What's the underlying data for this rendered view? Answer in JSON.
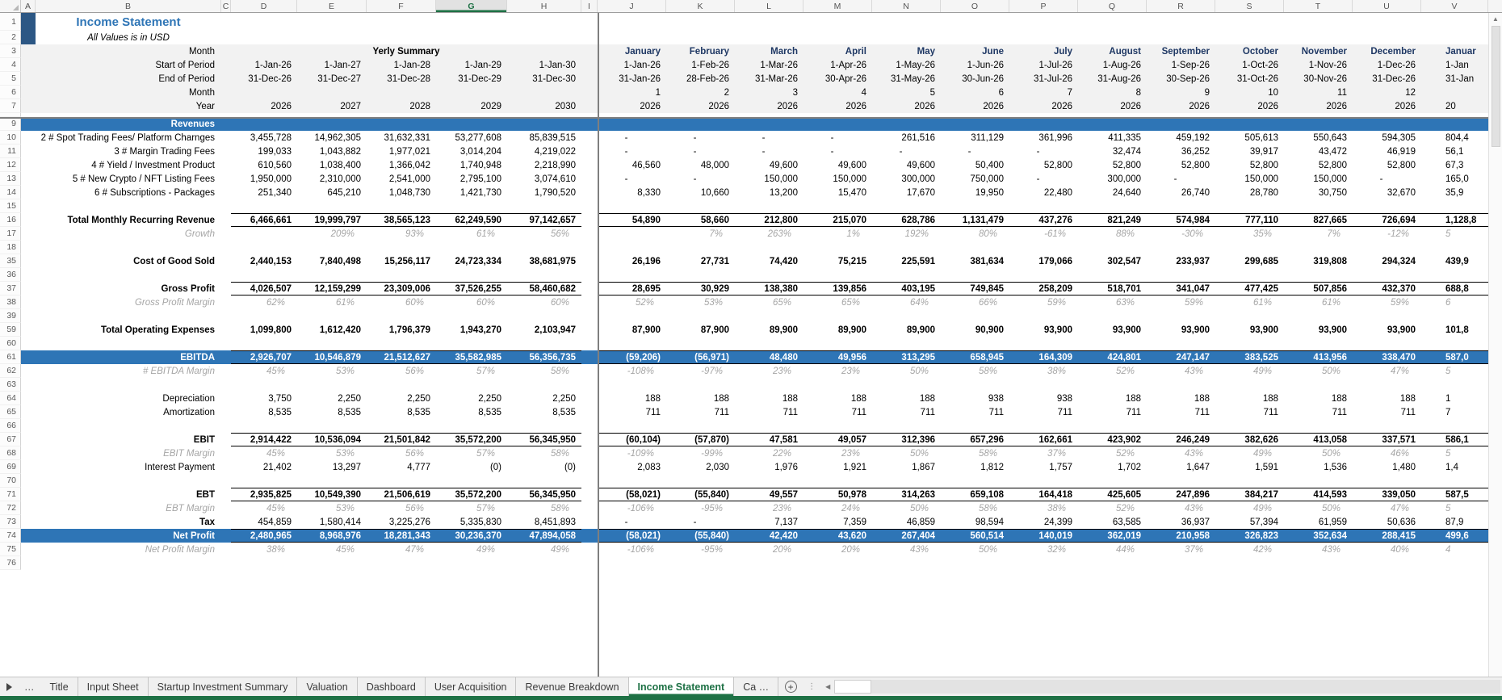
{
  "colors": {
    "banner_blue": "#2E75B6",
    "title_blue": "#2E75B6",
    "month_navy": "#1F3864",
    "side_bar_blue": "#2C5784",
    "excel_green": "#1E7145",
    "gray_text": "#A6A6A6",
    "header_bg": "#F2F2F2"
  },
  "columns": {
    "letters": [
      "A",
      "B",
      "C",
      "D",
      "E",
      "F",
      "G",
      "H",
      "I",
      "J",
      "K",
      "L",
      "M",
      "N",
      "O",
      "P",
      "Q",
      "R",
      "S",
      "T",
      "U",
      "V"
    ],
    "selected": "G"
  },
  "sheet": {
    "title": "Income Statement",
    "subtitle": "All Values is in USD",
    "header": {
      "row3_label": "Month",
      "yearly_span": "Yerly Summary",
      "row4_label": "Start of Period",
      "row5_label": "End of Period",
      "row6_label": "Month",
      "row7_label": "Year",
      "yearly_start": [
        "1-Jan-26",
        "1-Jan-27",
        "1-Jan-28",
        "1-Jan-29",
        "1-Jan-30"
      ],
      "yearly_end": [
        "31-Dec-26",
        "31-Dec-27",
        "31-Dec-28",
        "31-Dec-29",
        "31-Dec-30"
      ],
      "yearly_years": [
        "2026",
        "2027",
        "2028",
        "2029",
        "2030"
      ],
      "month_names": [
        "January",
        "February",
        "March",
        "April",
        "May",
        "June",
        "July",
        "August",
        "September",
        "October",
        "November",
        "December",
        "Januar"
      ],
      "month_start": [
        "1-Jan-26",
        "1-Feb-26",
        "1-Mar-26",
        "1-Apr-26",
        "1-May-26",
        "1-Jun-26",
        "1-Jul-26",
        "1-Aug-26",
        "1-Sep-26",
        "1-Oct-26",
        "1-Nov-26",
        "1-Dec-26",
        "1-Jan"
      ],
      "month_end": [
        "31-Jan-26",
        "28-Feb-26",
        "31-Mar-26",
        "30-Apr-26",
        "31-May-26",
        "30-Jun-26",
        "31-Jul-26",
        "31-Aug-26",
        "30-Sep-26",
        "31-Oct-26",
        "30-Nov-26",
        "31-Dec-26",
        "31-Jan"
      ],
      "month_numbers": [
        "1",
        "2",
        "3",
        "4",
        "5",
        "6",
        "7",
        "8",
        "9",
        "10",
        "11",
        "12",
        ""
      ],
      "month_years": [
        "2026",
        "2026",
        "2026",
        "2026",
        "2026",
        "2026",
        "2026",
        "2026",
        "2026",
        "2026",
        "2026",
        "2026",
        "20"
      ]
    },
    "rows": [
      {
        "n": "1",
        "kind": "title"
      },
      {
        "n": "2",
        "kind": "subtitle"
      },
      {
        "n": "3",
        "kind": "h-months"
      },
      {
        "n": "4",
        "kind": "h-dates",
        "label": "Start of Period",
        "yearly": [
          "1-Jan-26",
          "1-Jan-27",
          "1-Jan-28",
          "1-Jan-29",
          "1-Jan-30"
        ],
        "monthly": [
          "1-Jan-26",
          "1-Feb-26",
          "1-Mar-26",
          "1-Apr-26",
          "1-May-26",
          "1-Jun-26",
          "1-Jul-26",
          "1-Aug-26",
          "1-Sep-26",
          "1-Oct-26",
          "1-Nov-26",
          "1-Dec-26",
          "1-Jan"
        ]
      },
      {
        "n": "5",
        "kind": "h-dates",
        "label": "End of Period",
        "yearly": [
          "31-Dec-26",
          "31-Dec-27",
          "31-Dec-28",
          "31-Dec-29",
          "31-Dec-30"
        ],
        "monthly": [
          "31-Jan-26",
          "28-Feb-26",
          "31-Mar-26",
          "30-Apr-26",
          "31-May-26",
          "30-Jun-26",
          "31-Jul-26",
          "31-Aug-26",
          "30-Sep-26",
          "31-Oct-26",
          "30-Nov-26",
          "31-Dec-26",
          "31-Jan"
        ]
      },
      {
        "n": "6",
        "kind": "h-dates",
        "label": "Month",
        "yearly": [
          "",
          "",
          "",
          "",
          ""
        ],
        "monthly": [
          "1",
          "2",
          "3",
          "4",
          "5",
          "6",
          "7",
          "8",
          "9",
          "10",
          "11",
          "12",
          ""
        ]
      },
      {
        "n": "7",
        "kind": "h-dates",
        "label": "Year",
        "yearly": [
          "2026",
          "2027",
          "2028",
          "2029",
          "2030"
        ],
        "monthly": [
          "2026",
          "2026",
          "2026",
          "2026",
          "2026",
          "2026",
          "2026",
          "2026",
          "2026",
          "2026",
          "2026",
          "2026",
          "20"
        ]
      },
      {
        "n": "8",
        "kind": "tiny"
      },
      {
        "n": "9",
        "kind": "banner",
        "label": "Revenues"
      },
      {
        "n": "10",
        "kind": "item",
        "label": "2 # Spot Trading Fees/ Platform Charnges",
        "yearly": [
          "3,455,728",
          "14,962,305",
          "31,632,331",
          "53,277,608",
          "85,839,515"
        ],
        "monthly": [
          "-",
          "-",
          "-",
          "-",
          "261,516",
          "311,129",
          "361,996",
          "411,335",
          "459,192",
          "505,613",
          "550,643",
          "594,305",
          "804,4"
        ]
      },
      {
        "n": "11",
        "kind": "item",
        "label": "3 # Margin Trading Fees",
        "yearly": [
          "199,033",
          "1,043,882",
          "1,977,021",
          "3,014,204",
          "4,219,022"
        ],
        "monthly": [
          "-",
          "-",
          "-",
          "-",
          "-",
          "-",
          "-",
          "32,474",
          "36,252",
          "39,917",
          "43,472",
          "46,919",
          "56,1"
        ]
      },
      {
        "n": "12",
        "kind": "item",
        "label": "4 # Yield / Investment Product",
        "yearly": [
          "610,560",
          "1,038,400",
          "1,366,042",
          "1,740,948",
          "2,218,990"
        ],
        "monthly": [
          "46,560",
          "48,000",
          "49,600",
          "49,600",
          "49,600",
          "50,400",
          "52,800",
          "52,800",
          "52,800",
          "52,800",
          "52,800",
          "52,800",
          "67,3"
        ]
      },
      {
        "n": "13",
        "kind": "item",
        "label": "5 # New Crypto / NFT Listing Fees",
        "yearly": [
          "1,950,000",
          "2,310,000",
          "2,541,000",
          "2,795,100",
          "3,074,610"
        ],
        "monthly": [
          "-",
          "-",
          "150,000",
          "150,000",
          "300,000",
          "750,000",
          "-",
          "300,000",
          "-",
          "150,000",
          "150,000",
          "-",
          "165,0"
        ]
      },
      {
        "n": "14",
        "kind": "item",
        "label": "6 # Subscriptions - Packages",
        "yearly": [
          "251,340",
          "645,210",
          "1,048,730",
          "1,421,730",
          "1,790,520"
        ],
        "monthly": [
          "8,330",
          "10,660",
          "13,200",
          "15,470",
          "17,670",
          "19,950",
          "22,480",
          "24,640",
          "26,740",
          "28,780",
          "30,750",
          "32,670",
          "35,9"
        ]
      },
      {
        "n": "15",
        "kind": "spacer"
      },
      {
        "n": "16",
        "kind": "total",
        "label": "Total Monthly Recurring Revenue",
        "yearly": [
          "6,466,661",
          "19,999,797",
          "38,565,123",
          "62,249,590",
          "97,142,657"
        ],
        "monthly": [
          "54,890",
          "58,660",
          "212,800",
          "215,070",
          "628,786",
          "1,131,479",
          "437,276",
          "821,249",
          "574,984",
          "777,110",
          "827,665",
          "726,694",
          "1,128,8"
        ]
      },
      {
        "n": "17",
        "kind": "pct",
        "label": "Growth",
        "yearly": [
          "",
          "209%",
          "93%",
          "61%",
          "56%"
        ],
        "monthly": [
          "",
          "7%",
          "263%",
          "1%",
          "192%",
          "80%",
          "-61%",
          "88%",
          "-30%",
          "35%",
          "7%",
          "-12%",
          "5"
        ]
      },
      {
        "n": "18",
        "kind": "spacer"
      },
      {
        "n": "35",
        "kind": "bold",
        "label": "Cost of Good Sold",
        "yearly": [
          "2,440,153",
          "7,840,498",
          "15,256,117",
          "24,723,334",
          "38,681,975"
        ],
        "monthly": [
          "26,196",
          "27,731",
          "74,420",
          "75,215",
          "225,591",
          "381,634",
          "179,066",
          "302,547",
          "233,937",
          "299,685",
          "319,808",
          "294,324",
          "439,9"
        ]
      },
      {
        "n": "36",
        "kind": "spacer"
      },
      {
        "n": "37",
        "kind": "total",
        "label": "Gross Profit",
        "yearly": [
          "4,026,507",
          "12,159,299",
          "23,309,006",
          "37,526,255",
          "58,460,682"
        ],
        "monthly": [
          "28,695",
          "30,929",
          "138,380",
          "139,856",
          "403,195",
          "749,845",
          "258,209",
          "518,701",
          "341,047",
          "477,425",
          "507,856",
          "432,370",
          "688,8"
        ]
      },
      {
        "n": "38",
        "kind": "pct",
        "label": "Gross Profit Margin",
        "yearly": [
          "62%",
          "61%",
          "60%",
          "60%",
          "60%"
        ],
        "monthly": [
          "52%",
          "53%",
          "65%",
          "65%",
          "64%",
          "66%",
          "59%",
          "63%",
          "59%",
          "61%",
          "61%",
          "59%",
          "6"
        ]
      },
      {
        "n": "39",
        "kind": "spacer"
      },
      {
        "n": "59",
        "kind": "bold",
        "label": "Total Operating Expenses",
        "yearly": [
          "1,099,800",
          "1,612,420",
          "1,796,379",
          "1,943,270",
          "2,103,947"
        ],
        "monthly": [
          "87,900",
          "87,900",
          "89,900",
          "89,900",
          "89,900",
          "90,900",
          "93,900",
          "93,900",
          "93,900",
          "93,900",
          "93,900",
          "93,900",
          "101,8"
        ]
      },
      {
        "n": "60",
        "kind": "spacer"
      },
      {
        "n": "61",
        "kind": "banner-total",
        "label": "EBITDA",
        "yearly": [
          "2,926,707",
          "10,546,879",
          "21,512,627",
          "35,582,985",
          "56,356,735"
        ],
        "monthly": [
          "(59,206)",
          "(56,971)",
          "48,480",
          "49,956",
          "313,295",
          "658,945",
          "164,309",
          "424,801",
          "247,147",
          "383,525",
          "413,956",
          "338,470",
          "587,0"
        ]
      },
      {
        "n": "62",
        "kind": "pct",
        "label": "# EBITDA Margin",
        "yearly": [
          "45%",
          "53%",
          "56%",
          "57%",
          "58%"
        ],
        "monthly": [
          "-108%",
          "-97%",
          "23%",
          "23%",
          "50%",
          "58%",
          "38%",
          "52%",
          "43%",
          "49%",
          "50%",
          "47%",
          "5"
        ]
      },
      {
        "n": "63",
        "kind": "spacer"
      },
      {
        "n": "64",
        "kind": "plain",
        "label": "Depreciation",
        "yearly": [
          "3,750",
          "2,250",
          "2,250",
          "2,250",
          "2,250"
        ],
        "monthly": [
          "188",
          "188",
          "188",
          "188",
          "188",
          "938",
          "938",
          "188",
          "188",
          "188",
          "188",
          "188",
          "1"
        ]
      },
      {
        "n": "65",
        "kind": "plain",
        "label": "Amortization",
        "yearly": [
          "8,535",
          "8,535",
          "8,535",
          "8,535",
          "8,535"
        ],
        "monthly": [
          "711",
          "711",
          "711",
          "711",
          "711",
          "711",
          "711",
          "711",
          "711",
          "711",
          "711",
          "711",
          "7"
        ]
      },
      {
        "n": "66",
        "kind": "spacer"
      },
      {
        "n": "67",
        "kind": "total",
        "label": "EBIT",
        "yearly": [
          "2,914,422",
          "10,536,094",
          "21,501,842",
          "35,572,200",
          "56,345,950"
        ],
        "monthly": [
          "(60,104)",
          "(57,870)",
          "47,581",
          "49,057",
          "312,396",
          "657,296",
          "162,661",
          "423,902",
          "246,249",
          "382,626",
          "413,058",
          "337,571",
          "586,1"
        ]
      },
      {
        "n": "68",
        "kind": "pct",
        "label": "EBIT Margin",
        "yearly": [
          "45%",
          "53%",
          "56%",
          "57%",
          "58%"
        ],
        "monthly": [
          "-109%",
          "-99%",
          "22%",
          "23%",
          "50%",
          "58%",
          "37%",
          "52%",
          "43%",
          "49%",
          "50%",
          "46%",
          "5"
        ]
      },
      {
        "n": "69",
        "kind": "plain",
        "label": "Interest Payment",
        "yearly": [
          "21,402",
          "13,297",
          "4,777",
          "(0)",
          "(0)"
        ],
        "monthly": [
          "2,083",
          "2,030",
          "1,976",
          "1,921",
          "1,867",
          "1,812",
          "1,757",
          "1,702",
          "1,647",
          "1,591",
          "1,536",
          "1,480",
          "1,4"
        ]
      },
      {
        "n": "70",
        "kind": "spacer"
      },
      {
        "n": "71",
        "kind": "total",
        "label": "EBT",
        "yearly": [
          "2,935,825",
          "10,549,390",
          "21,506,619",
          "35,572,200",
          "56,345,950"
        ],
        "monthly": [
          "(58,021)",
          "(55,840)",
          "49,557",
          "50,978",
          "314,263",
          "659,108",
          "164,418",
          "425,605",
          "247,896",
          "384,217",
          "414,593",
          "339,050",
          "587,5"
        ]
      },
      {
        "n": "72",
        "kind": "pct",
        "label": "EBT Margin",
        "yearly": [
          "45%",
          "53%",
          "56%",
          "57%",
          "58%"
        ],
        "monthly": [
          "-106%",
          "-95%",
          "23%",
          "24%",
          "50%",
          "58%",
          "38%",
          "52%",
          "43%",
          "49%",
          "50%",
          "47%",
          "5"
        ]
      },
      {
        "n": "73",
        "kind": "tax",
        "label": "Tax",
        "yearly": [
          "454,859",
          "1,580,414",
          "3,225,276",
          "5,335,830",
          "8,451,893"
        ],
        "monthly": [
          "-",
          "-",
          "7,137",
          "7,359",
          "46,859",
          "98,594",
          "24,399",
          "63,585",
          "36,937",
          "57,394",
          "61,959",
          "50,636",
          "87,9"
        ]
      },
      {
        "n": "74",
        "kind": "banner-total",
        "label": "Net Profit",
        "yearly": [
          "2,480,965",
          "8,968,976",
          "18,281,343",
          "30,236,370",
          "47,894,058"
        ],
        "monthly": [
          "(58,021)",
          "(55,840)",
          "42,420",
          "43,620",
          "267,404",
          "560,514",
          "140,019",
          "362,019",
          "210,958",
          "326,823",
          "352,634",
          "288,415",
          "499,6"
        ]
      },
      {
        "n": "75",
        "kind": "pct",
        "label": "Net Profit Margin",
        "yearly": [
          "38%",
          "45%",
          "47%",
          "49%",
          "49%"
        ],
        "monthly": [
          "-106%",
          "-95%",
          "20%",
          "20%",
          "43%",
          "50%",
          "32%",
          "44%",
          "37%",
          "42%",
          "43%",
          "40%",
          "4"
        ]
      },
      {
        "n": "76",
        "kind": "spacer"
      }
    ]
  },
  "tabbar": {
    "overflow_indicator": "…",
    "tabs": [
      "Title",
      "Input Sheet",
      "Startup Investment Summary",
      "Valuation",
      "Dashboard",
      "User Acquisition",
      "Revenue Breakdown",
      "Income Statement"
    ],
    "active_tab": "Income Statement",
    "partial_tab": "Ca …",
    "add_sheet_label": "+",
    "kebab": "⋮"
  },
  "scrollbars": {
    "v_up_arrow": "▲",
    "h_left_arrow": "◀"
  }
}
